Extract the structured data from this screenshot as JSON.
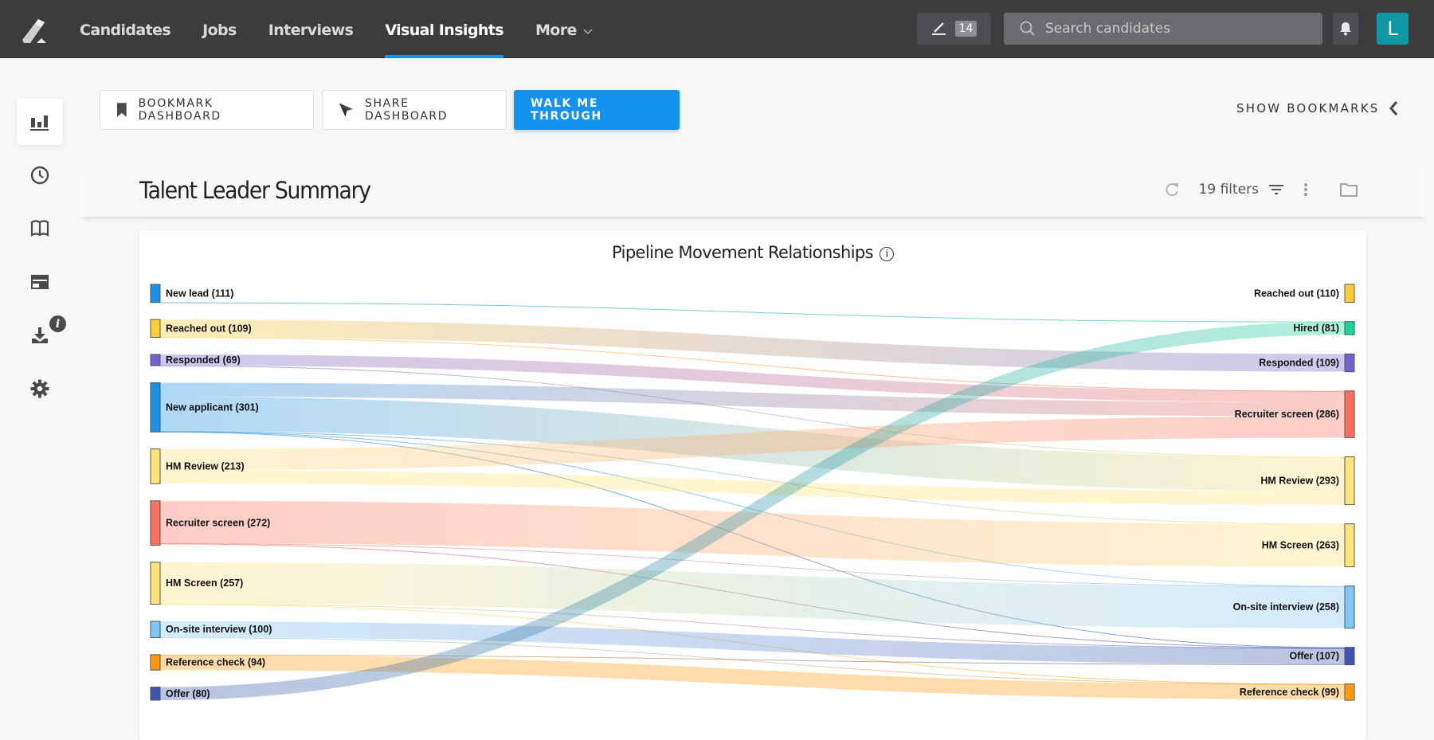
{
  "topbar": {
    "nav": [
      {
        "label": "Candidates",
        "active": false
      },
      {
        "label": "Jobs",
        "active": false
      },
      {
        "label": "Interviews",
        "active": false
      },
      {
        "label": "Visual Insights",
        "active": true
      },
      {
        "label": "More",
        "active": false
      }
    ],
    "edit_badge": "14",
    "search_placeholder": "Search candidates",
    "avatar_initial": "L"
  },
  "sidebar": {
    "items": [
      {
        "icon": "bar-chart-icon",
        "active": true
      },
      {
        "icon": "clock-icon",
        "active": false
      },
      {
        "icon": "book-icon",
        "active": false
      },
      {
        "icon": "card-icon",
        "active": false,
        "info_badge": "i"
      },
      {
        "icon": "download-icon",
        "active": false
      },
      {
        "icon": "gear-icon",
        "active": false
      }
    ]
  },
  "actions": {
    "bookmark": "BOOKMARK DASHBOARD",
    "share": "SHARE DASHBOARD",
    "walk": "WALK ME THROUGH",
    "show_bookmarks": "SHOW BOOKMARKS"
  },
  "dashboard": {
    "title": "Talent Leader Summary",
    "filters": "19 filters"
  },
  "chart_data": {
    "type": "sankey",
    "title": "Pipeline Movement Relationships",
    "left_nodes": [
      {
        "name": "New lead",
        "count": 111,
        "color": "#1a8fe8"
      },
      {
        "name": "Reached out",
        "count": 109,
        "color": "#ffcc33"
      },
      {
        "name": "Responded",
        "count": 69,
        "color": "#6d63cc"
      },
      {
        "name": "New applicant",
        "count": 301,
        "color": "#1a8fe8"
      },
      {
        "name": "HM Review",
        "count": 213,
        "color": "#ffe47a"
      },
      {
        "name": "Recruiter screen",
        "count": 272,
        "color": "#fd6f5e"
      },
      {
        "name": "HM Screen",
        "count": 257,
        "color": "#ffe47a"
      },
      {
        "name": "On-site interview",
        "count": 100,
        "color": "#80c8fa"
      },
      {
        "name": "Reference check",
        "count": 94,
        "color": "#ff9a12"
      },
      {
        "name": "Offer",
        "count": 80,
        "color": "#3f53ad"
      }
    ],
    "right_nodes": [
      {
        "name": "Reached out",
        "count": 110,
        "color": "#ffcc33"
      },
      {
        "name": "Hired",
        "count": 81,
        "color": "#1ad39a"
      },
      {
        "name": "Responded",
        "count": 109,
        "color": "#6d63cc"
      },
      {
        "name": "Recruiter screen",
        "count": 286,
        "color": "#fd6f5e"
      },
      {
        "name": "HM Review",
        "count": 293,
        "color": "#ffe47a"
      },
      {
        "name": "HM Screen",
        "count": 263,
        "color": "#ffe47a"
      },
      {
        "name": "On-site interview",
        "count": 258,
        "color": "#80c8fa"
      },
      {
        "name": "Offer",
        "count": 107,
        "color": "#3f53ad"
      },
      {
        "name": "Reference check",
        "count": 99,
        "color": "#ff9a12"
      }
    ],
    "links": [
      {
        "source": 0,
        "target": 0,
        "value": 110
      },
      {
        "source": 0,
        "target": 1,
        "value": 1
      },
      {
        "source": 1,
        "target": 2,
        "value": 108
      },
      {
        "source": 1,
        "target": 3,
        "value": 1
      },
      {
        "source": 2,
        "target": 3,
        "value": 68
      },
      {
        "source": 2,
        "target": 4,
        "value": 1
      },
      {
        "source": 3,
        "target": 3,
        "value": 86
      },
      {
        "source": 3,
        "target": 4,
        "value": 210
      },
      {
        "source": 3,
        "target": 5,
        "value": 2
      },
      {
        "source": 3,
        "target": 6,
        "value": 1
      },
      {
        "source": 3,
        "target": 7,
        "value": 2
      },
      {
        "source": 4,
        "target": 3,
        "value": 131
      },
      {
        "source": 4,
        "target": 4,
        "value": 82
      },
      {
        "source": 5,
        "target": 5,
        "value": 260
      },
      {
        "source": 5,
        "target": 7,
        "value": 2
      },
      {
        "source": 5,
        "target": 6,
        "value": 2
      },
      {
        "source": 6,
        "target": 6,
        "value": 255
      },
      {
        "source": 6,
        "target": 7,
        "value": 1
      },
      {
        "source": 6,
        "target": 8,
        "value": 1
      },
      {
        "source": 7,
        "target": 7,
        "value": 98
      },
      {
        "source": 7,
        "target": 8,
        "value": 2
      },
      {
        "source": 8,
        "target": 7,
        "value": 2
      },
      {
        "source": 8,
        "target": 8,
        "value": 92
      },
      {
        "source": 9,
        "target": 1,
        "value": 80
      }
    ]
  }
}
